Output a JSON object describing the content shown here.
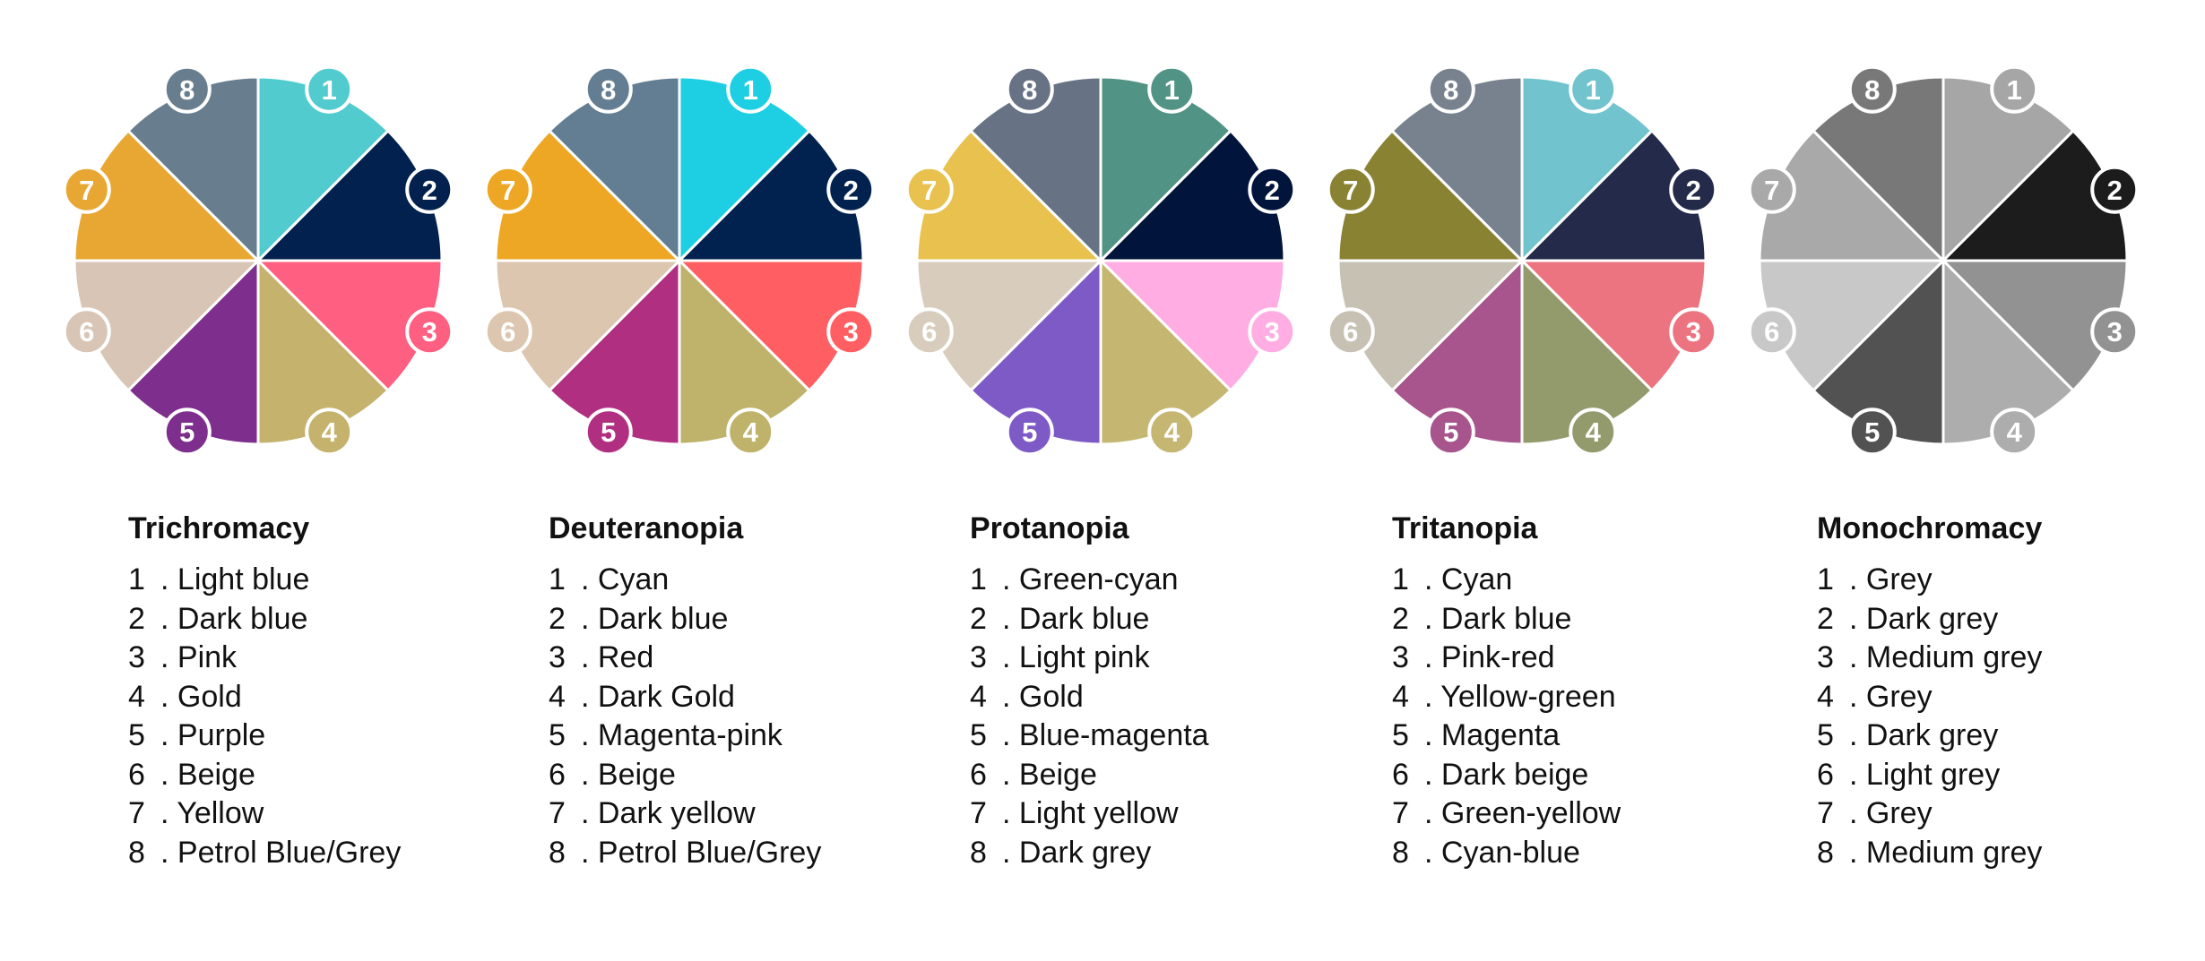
{
  "panels": [
    {
      "title": "Trichromacy",
      "items": [
        {
          "num": "1",
          "label": "Light blue",
          "color": "#52cbcf"
        },
        {
          "num": "2",
          "label": "Dark blue",
          "color": "#02214f"
        },
        {
          "num": "3",
          "label": "Pink",
          "color": "#ff5f80"
        },
        {
          "num": "4",
          "label": "Gold",
          "color": "#c5b26d"
        },
        {
          "num": "5",
          "label": "Purple",
          "color": "#7e2e8c"
        },
        {
          "num": "6",
          "label": "Beige",
          "color": "#d8c5b5"
        },
        {
          "num": "7",
          "label": "Yellow",
          "color": "#e8a732"
        },
        {
          "num": "8",
          "label": "Petrol Blue/Grey",
          "color": "#687d8e"
        }
      ]
    },
    {
      "title": "Deuteranopia",
      "items": [
        {
          "num": "1",
          "label": "Cyan",
          "color": "#1ecfe4"
        },
        {
          "num": "2",
          "label": "Dark blue",
          "color": "#01224f"
        },
        {
          "num": "3",
          "label": "Red",
          "color": "#ff5f62"
        },
        {
          "num": "4",
          "label": "Dark Gold",
          "color": "#bfb36b"
        },
        {
          "num": "5",
          "label": "Magenta-pink",
          "color": "#b12f80"
        },
        {
          "num": "6",
          "label": "Beige",
          "color": "#dcc6af"
        },
        {
          "num": "7",
          "label": "Dark yellow",
          "color": "#eea725"
        },
        {
          "num": "8",
          "label": "Petrol Blue/Grey",
          "color": "#637e92"
        }
      ]
    },
    {
      "title": "Protanopia",
      "items": [
        {
          "num": "1",
          "label": "Green-cyan",
          "color": "#519384"
        },
        {
          "num": "2",
          "label": "Dark blue",
          "color": "#01143c"
        },
        {
          "num": "3",
          "label": "Light pink",
          "color": "#ffade3"
        },
        {
          "num": "4",
          "label": "Gold",
          "color": "#c5b772"
        },
        {
          "num": "5",
          "label": "Blue-magenta",
          "color": "#7e5ac6"
        },
        {
          "num": "6",
          "label": "Beige",
          "color": "#d8cdbd"
        },
        {
          "num": "7",
          "label": "Light yellow",
          "color": "#e8c14f"
        },
        {
          "num": "8",
          "label": "Dark grey",
          "color": "#677384"
        }
      ]
    },
    {
      "title": "Tritanopia",
      "items": [
        {
          "num": "1",
          "label": "Cyan",
          "color": "#71c3cd"
        },
        {
          "num": "2",
          "label": "Dark blue",
          "color": "#242a4a"
        },
        {
          "num": "3",
          "label": "Pink-red",
          "color": "#ec7480"
        },
        {
          "num": "4",
          "label": "Yellow-green",
          "color": "#939b6d"
        },
        {
          "num": "5",
          "label": "Magenta",
          "color": "#a7558c"
        },
        {
          "num": "6",
          "label": "Dark beige",
          "color": "#c7c1b4"
        },
        {
          "num": "7",
          "label": "Green-yellow",
          "color": "#8a8233"
        },
        {
          "num": "8",
          "label": "Cyan-blue",
          "color": "#78828f"
        }
      ]
    },
    {
      "title": "Monochromacy",
      "items": [
        {
          "num": "1",
          "label": "Grey",
          "color": "#a6a6a6"
        },
        {
          "num": "2",
          "label": "Dark grey",
          "color": "#1c1c1c"
        },
        {
          "num": "3",
          "label": "Medium grey",
          "color": "#929292"
        },
        {
          "num": "4",
          "label": "Grey",
          "color": "#adadad"
        },
        {
          "num": "5",
          "label": "Dark grey",
          "color": "#525252"
        },
        {
          "num": "6",
          "label": "Light grey",
          "color": "#c8c8c8"
        },
        {
          "num": "7",
          "label": "Grey",
          "color": "#a9a9a9"
        },
        {
          "num": "8",
          "label": "Medium grey",
          "color": "#787878"
        }
      ]
    }
  ]
}
